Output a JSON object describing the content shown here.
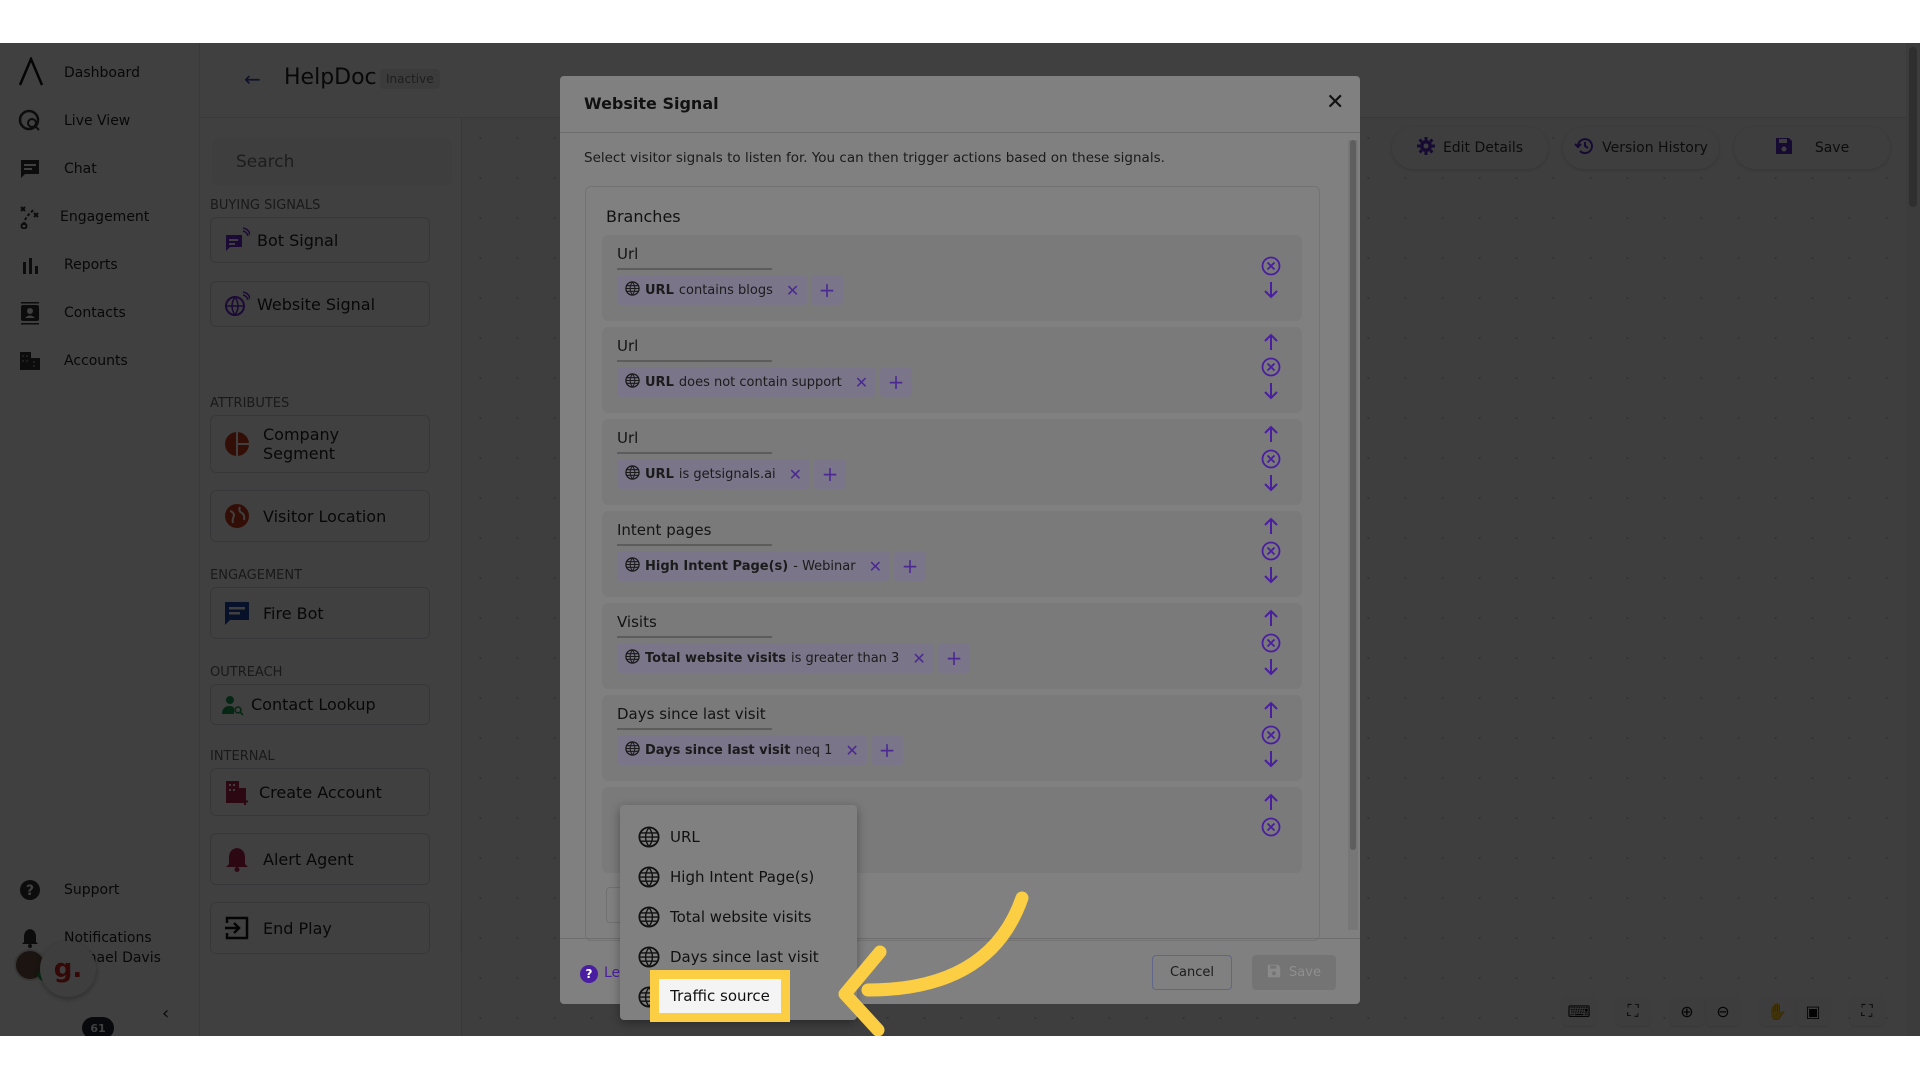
{
  "nav": {
    "items": [
      {
        "label": "Dashboard",
        "icon": "logo-icon"
      },
      {
        "label": "Live View",
        "icon": "live-view-icon"
      },
      {
        "label": "Chat",
        "icon": "chat-icon"
      },
      {
        "label": "Engagement",
        "icon": "engagement-icon"
      },
      {
        "label": "Reports",
        "icon": "reports-icon"
      },
      {
        "label": "Contacts",
        "icon": "contacts-icon"
      },
      {
        "label": "Accounts",
        "icon": "accounts-icon"
      }
    ],
    "bottom": [
      {
        "label": "Support",
        "icon": "help-circle-icon"
      },
      {
        "label": "Notifications",
        "icon": "bell-icon"
      }
    ],
    "user_name": "Michael Davis",
    "widget_badge_count": "61",
    "widget_letter": "g."
  },
  "header": {
    "title": "HelpDoc",
    "status": "Inactive",
    "buttons": {
      "edit_details": "Edit Details",
      "version_history": "Version History",
      "save": "Save"
    }
  },
  "panel": {
    "search_placeholder": "Search",
    "sections": [
      {
        "label": "Buying Signals",
        "nodes": [
          "Bot Signal",
          "Website Signal"
        ]
      },
      {
        "label": "Attributes",
        "nodes": [
          "Company Segment",
          "Visitor Location"
        ]
      },
      {
        "label": "Engagement",
        "nodes": [
          "Fire Bot"
        ]
      },
      {
        "label": "Outreach",
        "nodes": [
          "Contact Lookup"
        ]
      },
      {
        "label": "Internal",
        "nodes": [
          "Create Account",
          "Alert Agent",
          "End Play"
        ]
      }
    ]
  },
  "modal": {
    "title": "Website Signal",
    "description": "Select visitor signals to listen for. You can then trigger actions based on these signals.",
    "branches_title": "Branches",
    "branches": [
      {
        "name": "Url",
        "field": "URL",
        "condition": "contains blogs"
      },
      {
        "name": "Url",
        "field": "URL",
        "condition": "does not contain support"
      },
      {
        "name": "Url",
        "field": "URL",
        "condition": "is getsignals.ai"
      },
      {
        "name": "Intent pages",
        "field": "High Intent Page(s)",
        "condition": "- Webinar"
      },
      {
        "name": "Visits",
        "field": "Total website visits",
        "condition": "is greater than 3"
      },
      {
        "name": "Days since last visit",
        "field": "Days since last visit",
        "condition": "neq 1"
      },
      {
        "name": "",
        "field": "",
        "condition": ""
      }
    ],
    "help_link": "Learn more",
    "cancel": "Cancel",
    "save": "Save"
  },
  "dropdown": {
    "options": [
      "URL",
      "High Intent Page(s)",
      "Total website visits",
      "Days since last visit",
      "Traffic source"
    ],
    "highlighted": "Traffic source"
  },
  "colors": {
    "accent": "#5b2bc8",
    "annotation": "#fcce44"
  }
}
